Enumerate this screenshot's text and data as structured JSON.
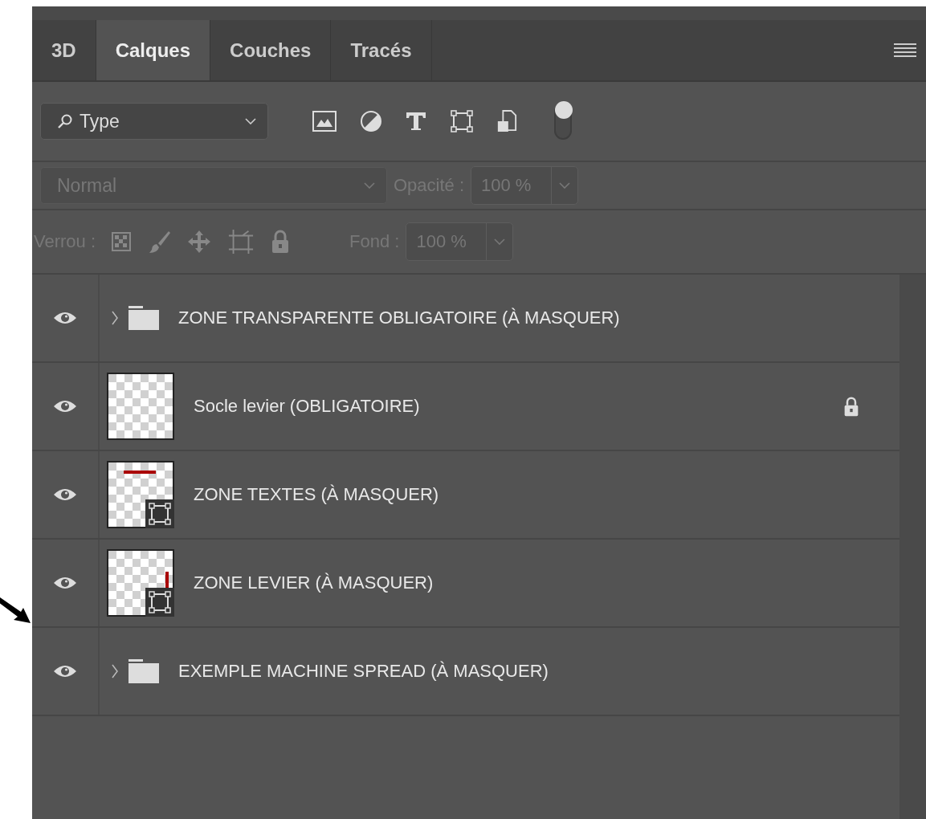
{
  "tabs": [
    {
      "label": "3D",
      "selected": false
    },
    {
      "label": "Calques",
      "selected": true
    },
    {
      "label": "Couches",
      "selected": false
    },
    {
      "label": "Tracés",
      "selected": false
    }
  ],
  "filter": {
    "value": "Type",
    "on": true
  },
  "blend": {
    "value": "Normal",
    "disabled": true,
    "opacity_label": "Opacité :",
    "opacity": "100 %"
  },
  "lock": {
    "label": "Verrou :",
    "fill_label": "Fond :",
    "fill": "100 %",
    "disabled": true
  },
  "layers": [
    {
      "kind": "folder",
      "name": "ZONE TRANSPARENTE OBLIGATOIRE (À MASQUER)",
      "visible": true,
      "expanded": false,
      "locked": false
    },
    {
      "kind": "layer",
      "name": "Socle levier (OBLIGATOIRE)",
      "visible": true,
      "thumbnail": {
        "kind": "empty",
        "shape": false
      },
      "locked": true
    },
    {
      "kind": "layer",
      "name": "ZONE TEXTES (À MASQUER)",
      "visible": true,
      "thumbnail": {
        "kind": "top-bar",
        "shape": true
      },
      "locked": false
    },
    {
      "kind": "layer",
      "name": "ZONE LEVIER (À MASQUER)",
      "visible": true,
      "thumbnail": {
        "kind": "side-bar",
        "shape": true
      },
      "locked": false
    },
    {
      "kind": "folder",
      "name": "EXEMPLE MACHINE SPREAD (À MASQUER)",
      "visible": true,
      "expanded": false,
      "locked": false
    }
  ]
}
